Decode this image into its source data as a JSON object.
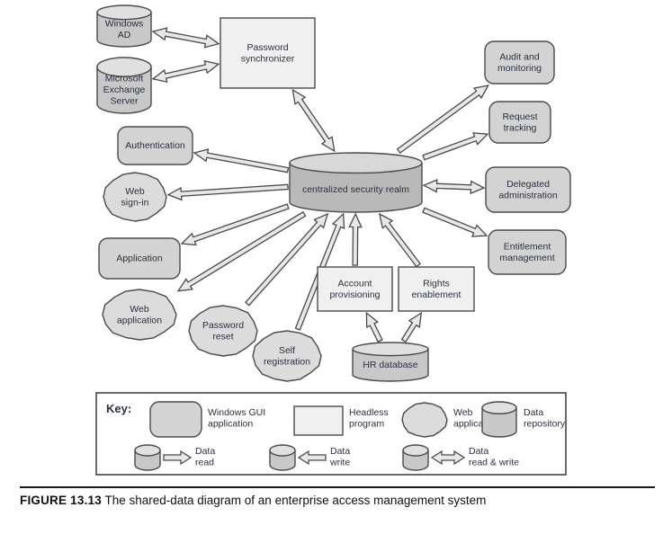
{
  "figure": {
    "label": "FIGURE 13.13",
    "caption": "The shared-data diagram of an enterprise access management system"
  },
  "diagram": {
    "center": {
      "label": "centralized security realm",
      "shape": "data-repository"
    },
    "nodes": [
      {
        "id": "windows-ad",
        "label_lines": [
          "Windows",
          "AD"
        ],
        "shape": "data-repository"
      },
      {
        "id": "microsoft-exchange",
        "label_lines": [
          "Microsoft",
          "Exchange",
          "Server"
        ],
        "shape": "data-repository"
      },
      {
        "id": "password-synchronizer",
        "label_lines": [
          "Password",
          "synchronizer"
        ],
        "shape": "headless-program"
      },
      {
        "id": "authentication",
        "label_lines": [
          "Authentication"
        ],
        "shape": "windows-gui-application"
      },
      {
        "id": "web-sign-in",
        "label_lines": [
          "Web",
          "sign-in"
        ],
        "shape": "web-application"
      },
      {
        "id": "application",
        "label_lines": [
          "Application"
        ],
        "shape": "windows-gui-application"
      },
      {
        "id": "web-application",
        "label_lines": [
          "Web",
          "application"
        ],
        "shape": "web-application"
      },
      {
        "id": "password-reset",
        "label_lines": [
          "Password",
          "reset"
        ],
        "shape": "web-application"
      },
      {
        "id": "self-registration",
        "label_lines": [
          "Self",
          "registration"
        ],
        "shape": "web-application"
      },
      {
        "id": "account-provisioning",
        "label_lines": [
          "Account",
          "provisioning"
        ],
        "shape": "headless-program"
      },
      {
        "id": "rights-enablement",
        "label_lines": [
          "Rights",
          "enablement"
        ],
        "shape": "headless-program"
      },
      {
        "id": "hr-database",
        "label_lines": [
          "HR database"
        ],
        "shape": "data-repository"
      },
      {
        "id": "audit-and-monitoring",
        "label_lines": [
          "Audit and",
          "monitoring"
        ],
        "shape": "windows-gui-application"
      },
      {
        "id": "request-tracking",
        "label_lines": [
          "Request",
          "tracking"
        ],
        "shape": "windows-gui-application"
      },
      {
        "id": "delegated-administration",
        "label_lines": [
          "Delegated",
          "administration"
        ],
        "shape": "windows-gui-application"
      },
      {
        "id": "entitlement-management",
        "label_lines": [
          "Entitlement",
          "management"
        ],
        "shape": "windows-gui-application"
      }
    ],
    "connections": [
      {
        "from": "password-synchronizer",
        "to": "windows-ad",
        "kind": "data-read-and-write"
      },
      {
        "from": "password-synchronizer",
        "to": "microsoft-exchange",
        "kind": "data-read-and-write"
      },
      {
        "from": "centralized-security-realm",
        "to": "password-synchronizer",
        "kind": "data-read-and-write"
      },
      {
        "from": "centralized-security-realm",
        "to": "authentication",
        "kind": "data-read"
      },
      {
        "from": "centralized-security-realm",
        "to": "web-sign-in",
        "kind": "data-read"
      },
      {
        "from": "centralized-security-realm",
        "to": "application",
        "kind": "data-read"
      },
      {
        "from": "centralized-security-realm",
        "to": "web-application",
        "kind": "data-read"
      },
      {
        "from": "password-reset",
        "to": "centralized-security-realm",
        "kind": "data-write"
      },
      {
        "from": "self-registration",
        "to": "centralized-security-realm",
        "kind": "data-write"
      },
      {
        "from": "account-provisioning",
        "to": "centralized-security-realm",
        "kind": "data-write"
      },
      {
        "from": "rights-enablement",
        "to": "centralized-security-realm",
        "kind": "data-write"
      },
      {
        "from": "hr-database",
        "to": "account-provisioning",
        "kind": "data-read"
      },
      {
        "from": "hr-database",
        "to": "rights-enablement",
        "kind": "data-read"
      },
      {
        "from": "centralized-security-realm",
        "to": "audit-and-monitoring",
        "kind": "data-read"
      },
      {
        "from": "centralized-security-realm",
        "to": "request-tracking",
        "kind": "data-read"
      },
      {
        "from": "centralized-security-realm",
        "to": "delegated-administration",
        "kind": "data-read-and-write"
      },
      {
        "from": "centralized-security-realm",
        "to": "entitlement-management",
        "kind": "data-read"
      }
    ]
  },
  "key": {
    "title": "Key:",
    "shapes": [
      {
        "id": "windows-gui-application",
        "label_lines": [
          "Windows GUI",
          "application"
        ]
      },
      {
        "id": "headless-program",
        "label_lines": [
          "Headless",
          "program"
        ]
      },
      {
        "id": "web-application",
        "label_lines": [
          "Web",
          "application"
        ]
      },
      {
        "id": "data-repository",
        "label_lines": [
          "Data",
          "repository"
        ]
      }
    ],
    "arrows": [
      {
        "id": "data-read",
        "label_lines": [
          "Data",
          "read"
        ]
      },
      {
        "id": "data-write",
        "label_lines": [
          "Data",
          "write"
        ]
      },
      {
        "id": "data-read-and-write",
        "label_lines": [
          "Data",
          "read & write"
        ]
      }
    ]
  },
  "colors": {
    "gui_fill": "#d3d3d3",
    "headless_fill": "#f0f0f0",
    "web_fill": "#dcdcdc",
    "repo_fill": "#c8c8c8",
    "repo_top": "#e0e0e0",
    "center_fill": "#b9b9b9",
    "center_top": "#d8d8d8",
    "arrow_fill": "#e8e8e8",
    "stroke": "#4a4a4a",
    "text": "#2b3040"
  }
}
